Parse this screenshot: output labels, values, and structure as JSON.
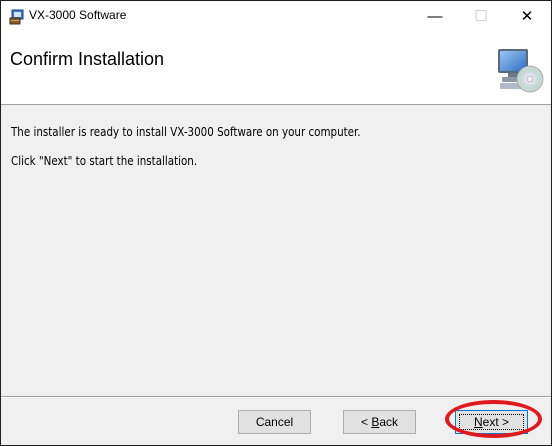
{
  "window": {
    "title": "VX-3000 Software",
    "app_icon": "installer-icon",
    "controls": {
      "minimize": "—",
      "maximize": "☐",
      "close": "✕"
    }
  },
  "banner": {
    "title": "Confirm Installation",
    "icon": "computer-cd-icon"
  },
  "content": {
    "line1": "The installer is ready to install VX-3000 Software on your computer.",
    "line2": "Click \"Next\" to start the installation."
  },
  "buttons": {
    "cancel": "Cancel",
    "back_prefix": "< ",
    "back_accel": "B",
    "back_rest": "ack",
    "next_accel": "N",
    "next_rest": "ext >"
  },
  "colors": {
    "highlight_ellipse": "#e0191f",
    "focus_border": "#0078d7"
  }
}
